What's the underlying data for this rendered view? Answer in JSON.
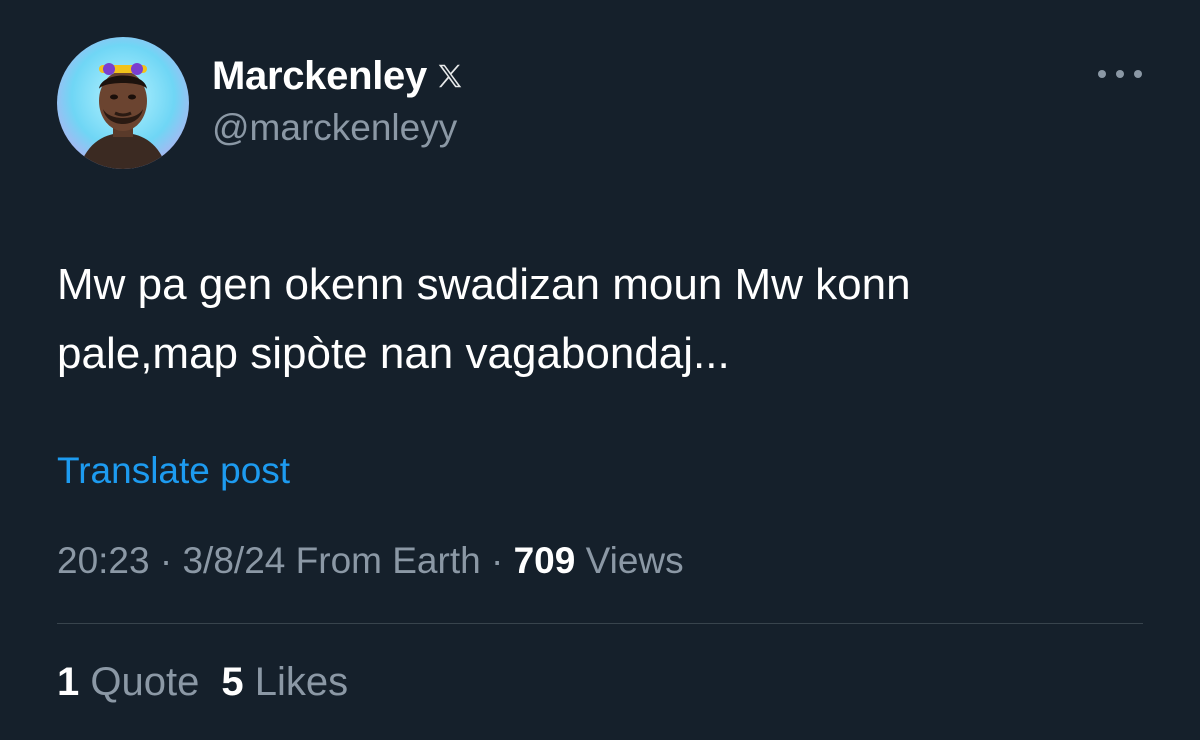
{
  "author": {
    "display_name": "Marckenley",
    "handle": "@marckenleyy",
    "verified_badge_icon": "x-logo-icon",
    "avatar_icon": "avatar-portrait-icon"
  },
  "menu": {
    "more_icon": "more-dots-icon"
  },
  "tweet": {
    "text": "Mw pa gen okenn swadizan moun Mw konn\npale,map sipòte nan vagabondaj...",
    "translate_label": "Translate post"
  },
  "meta": {
    "time": "20:23",
    "separator": "·",
    "date": "3/8/24",
    "location": "From Earth",
    "views_count": "709",
    "views_label": "Views"
  },
  "stats": {
    "quotes_count": "1",
    "quotes_label": "Quote",
    "likes_count": "5",
    "likes_label": "Likes"
  },
  "colors": {
    "background": "#15202b",
    "primary_text": "#ffffff",
    "secondary_text": "#8b98a5",
    "link": "#1d9bf0",
    "divider": "#38444d"
  }
}
